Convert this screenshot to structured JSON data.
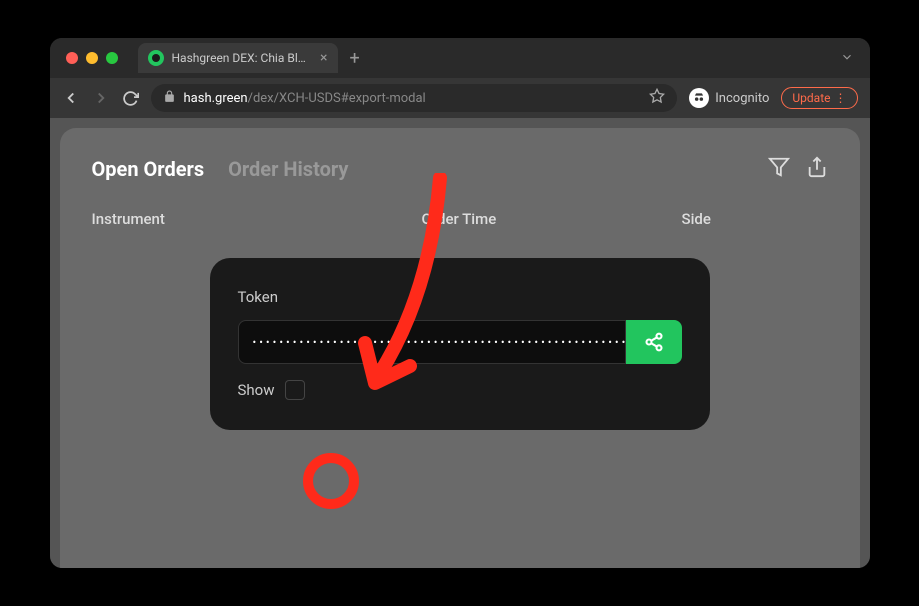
{
  "browser": {
    "tab_title": "Hashgreen DEX: Chia Blockcha",
    "url_host": "hash.green",
    "url_path": "/dex/XCH-USDS#export-modal",
    "incognito_label": "Incognito",
    "update_label": "Update"
  },
  "app": {
    "tabs": {
      "open_orders": "Open Orders",
      "order_history": "Order History"
    },
    "headers": {
      "instrument": "Instrument",
      "order_time": "Order Time",
      "side": "Side"
    }
  },
  "modal": {
    "token_label": "Token",
    "token_value": "••••••••••••••••••••••••••••••••••••••••••••••••••••••••••••••••••••••",
    "show_label": "Show"
  }
}
